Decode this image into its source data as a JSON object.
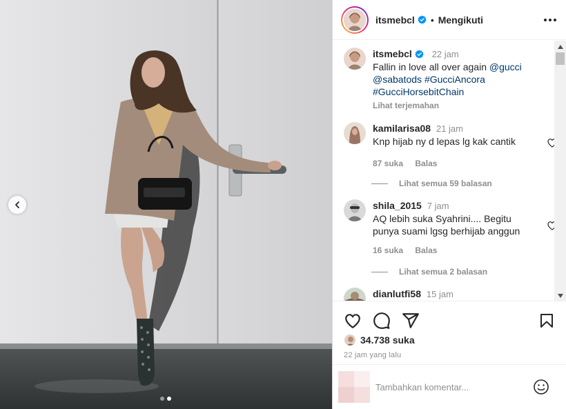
{
  "post": {
    "author": "itsmebcl",
    "follow_status": "Mengikuti",
    "caption_time": "22 jam",
    "caption_text": "Fallin in love all over again ",
    "caption_tags": [
      "@gucci",
      "@sabatods",
      "#GucciAncora",
      "#GucciHorsebitChain"
    ],
    "translate_label": "Lihat terjemahan",
    "likes": "34.738 suka",
    "posted_ago": "22 jam yang lalu",
    "carousel": {
      "count": 2,
      "active_index": 1
    }
  },
  "comments": [
    {
      "user": "kamilarisa08",
      "time": "21 jam",
      "text": "Knp hijab ny d lepas lg kak cantik",
      "likes": "87 suka",
      "reply_label": "Balas",
      "view_replies": "Lihat semua 59 balasan"
    },
    {
      "user": "shila_2015",
      "time": "7 jam",
      "text": "AQ lebih suka Syahrini.... Begitu punya suami lgsg berhijab anggun",
      "likes": "16 suka",
      "reply_label": "Balas",
      "view_replies": "Lihat semua 2 balasan"
    },
    {
      "user": "dianlutfi58",
      "time": "15 jam"
    }
  ],
  "composer": {
    "placeholder": "Tambahkan komentar..."
  },
  "icons": {
    "header": [
      "verified-badge-icon",
      "more-options-icon"
    ],
    "actions": [
      "heart-icon",
      "comment-icon",
      "share-icon",
      "bookmark-icon"
    ],
    "composer": [
      "emoji-icon"
    ],
    "carousel": [
      "chevron-left-icon"
    ]
  },
  "colors": {
    "accent_link": "#00376b",
    "verified_blue": "#0095f6",
    "muted_text": "#8e8e8e"
  }
}
